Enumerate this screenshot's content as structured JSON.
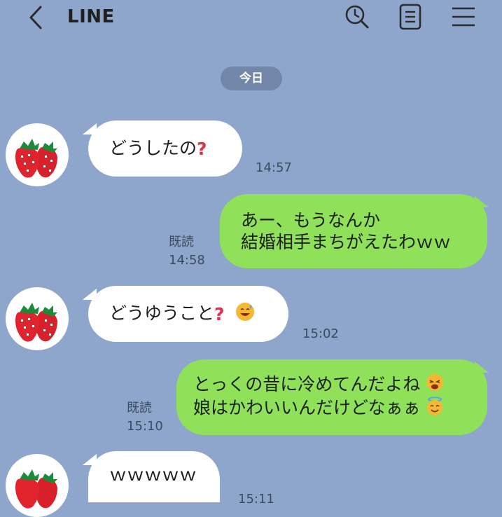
{
  "header": {
    "title": "LINE",
    "icons": [
      "back-icon",
      "search-icon",
      "note-icon",
      "menu-icon"
    ]
  },
  "date_separator": "今日",
  "messages": [
    {
      "side": "in",
      "lines": [
        "どうした?"
      ],
      "text": "どうしたの",
      "emoji": "question-mark",
      "time": "14:57"
    },
    {
      "side": "out",
      "lines": [
        "あー、もうなんか",
        "結婚相手まちがえたわｗｗ"
      ],
      "read": "既読",
      "time": "14:58"
    },
    {
      "side": "in",
      "text": "どうゆうこと",
      "emoji": [
        "question-mark",
        "sweat-smile"
      ],
      "time": "15:02"
    },
    {
      "side": "out",
      "lines": [
        "とっくの昔に冷めてんだよね",
        "娘はかわいいんだけどなぁぁ"
      ],
      "emoji": [
        "tired-face",
        "halo-face"
      ],
      "read": "既読",
      "time": "15:10"
    },
    {
      "side": "in",
      "text": "ｗｗｗｗｗ",
      "time": "15:11"
    }
  ],
  "colors": {
    "background": "#8ea6cc",
    "incoming_bubble": "#ffffff",
    "outgoing_bubble": "#8fe15a",
    "date_pill": "#7186a8"
  }
}
